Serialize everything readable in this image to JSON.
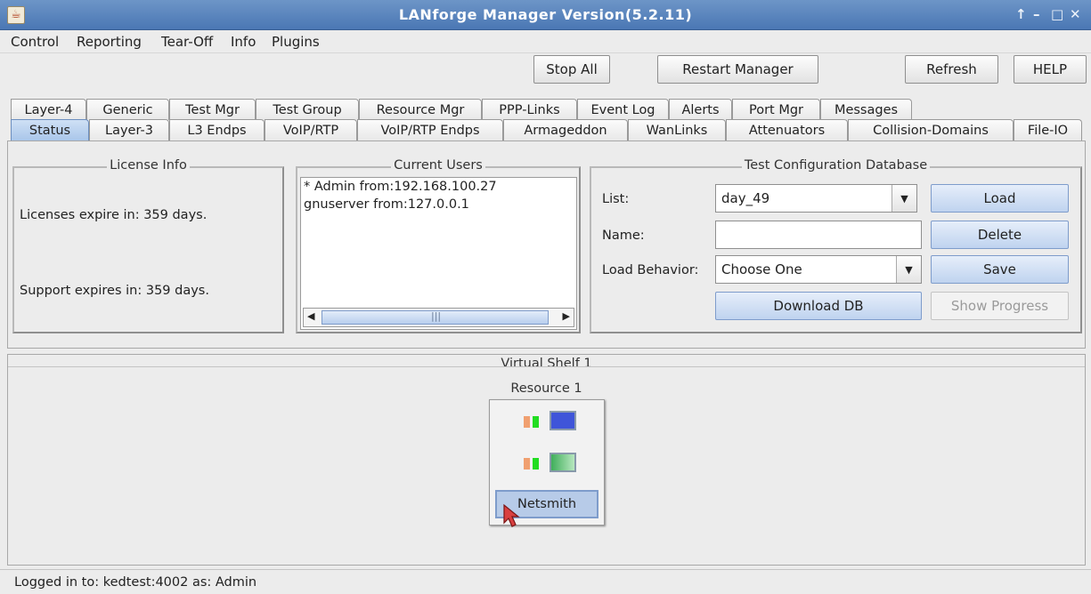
{
  "window": {
    "title": "LANforge Manager   Version(5.2.11)",
    "controls": [
      "↑",
      "–",
      "□",
      "✕"
    ]
  },
  "menu": [
    "Control",
    "Reporting",
    "Tear-Off",
    "Info",
    "Plugins"
  ],
  "toolbar": {
    "stop_all": "Stop All",
    "restart_manager": "Restart Manager",
    "refresh": "Refresh",
    "help": "HELP"
  },
  "tabs_top": [
    "Layer-4",
    "Generic",
    "Test Mgr",
    "Test Group",
    "Resource Mgr",
    "PPP-Links",
    "Event Log",
    "Alerts",
    "Port Mgr",
    "Messages"
  ],
  "tabs_bottom": [
    "Status",
    "Layer-3",
    "L3 Endps",
    "VoIP/RTP",
    "VoIP/RTP Endps",
    "Armageddon",
    "WanLinks",
    "Attenuators",
    "Collision-Domains",
    "File-IO"
  ],
  "active_tab": "Status",
  "license_info": {
    "title": "License Info",
    "licenses": "Licenses expire in: 359 days.",
    "support": "Support expires in: 359 days."
  },
  "current_users": {
    "title": "Current Users",
    "users": [
      "* Admin from:192.168.100.27",
      "gnuserver from:127.0.0.1"
    ]
  },
  "test_config_db": {
    "title": "Test Configuration Database",
    "list_label": "List:",
    "list_value": "day_49",
    "name_label": "Name:",
    "name_value": "",
    "load_behavior_label": "Load Behavior:",
    "load_behavior_value": "Choose One",
    "load": "Load",
    "delete": "Delete",
    "save": "Save",
    "download_db": "Download DB",
    "show_progress": "Show Progress"
  },
  "shelf": {
    "title": "Virtual Shelf 1",
    "resource_title": "Resource 1",
    "resource_name": "Netsmith",
    "colors": {
      "port1": "#3f55d9",
      "port2": "#5cbf6a",
      "led_orange": "#f0a070",
      "led_green": "#22dd22"
    }
  },
  "status": {
    "text": "Logged in to:  kedtest:4002  as:  Admin"
  }
}
